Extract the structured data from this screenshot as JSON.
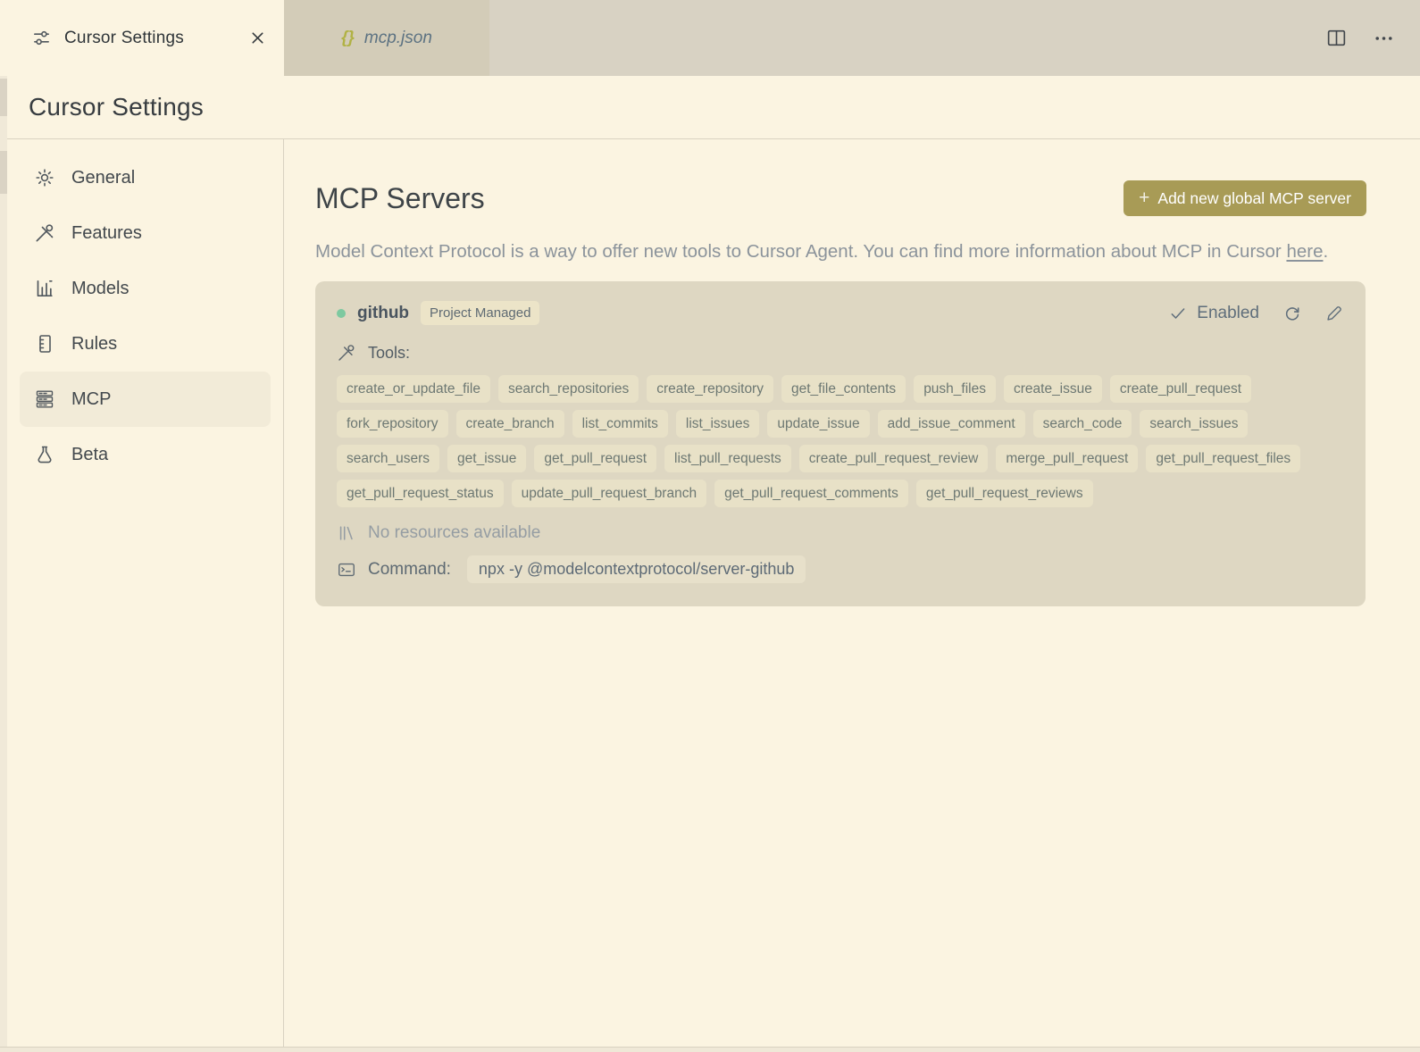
{
  "tabs": {
    "settings": {
      "label": "Cursor Settings"
    },
    "mcp_json": {
      "label": "mcp.json",
      "glyph": "{}"
    }
  },
  "header": {
    "title": "Cursor Settings"
  },
  "sidebar": {
    "items": [
      {
        "label": "General"
      },
      {
        "label": "Features"
      },
      {
        "label": "Models"
      },
      {
        "label": "Rules"
      },
      {
        "label": "MCP"
      },
      {
        "label": "Beta"
      }
    ]
  },
  "main": {
    "title": "MCP Servers",
    "add_button_plus": "+",
    "add_button_label": "Add new global MCP server",
    "description": {
      "before": "Model Context Protocol is a way to offer new tools to Cursor Agent. You can find more information about MCP in Cursor ",
      "link": "here",
      "after": "."
    },
    "server": {
      "name": "github",
      "badge": "Project Managed",
      "status_label": "Enabled",
      "tools_label": "Tools:",
      "tools": [
        "create_or_update_file",
        "search_repositories",
        "create_repository",
        "get_file_contents",
        "push_files",
        "create_issue",
        "create_pull_request",
        "fork_repository",
        "create_branch",
        "list_commits",
        "list_issues",
        "update_issue",
        "add_issue_comment",
        "search_code",
        "search_issues",
        "search_users",
        "get_issue",
        "get_pull_request",
        "list_pull_requests",
        "create_pull_request_review",
        "merge_pull_request",
        "get_pull_request_files",
        "get_pull_request_status",
        "update_pull_request_branch",
        "get_pull_request_comments",
        "get_pull_request_reviews"
      ],
      "resources_text": "No resources available",
      "command_label": "Command:",
      "command": "npx -y @modelcontextprotocol/server-github"
    }
  },
  "colors": {
    "accent_olive": "#a89b56",
    "status_green": "#7dc9a0",
    "json_icon_olive": "#b1b245",
    "card_bg": "#ded7c2",
    "chip_bg": "#e8e1c7",
    "page_bg": "#fbf4e1"
  }
}
